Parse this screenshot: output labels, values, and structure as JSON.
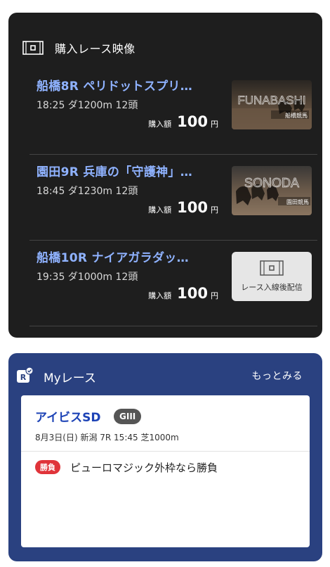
{
  "purchased_videos": {
    "title": "購入レース映像",
    "header_icon": "film-frame-icon",
    "races": [
      {
        "title": "船橋8R ペリドットスプリ…",
        "meta": "18:25 ダ1200m 12頭",
        "amount_label": "購入額",
        "amount": "100",
        "currency": "円",
        "thumbnail": {
          "text": "FUNABASHI",
          "caption": "船橋競馬",
          "tint": "#5a4a3a"
        }
      },
      {
        "title": "園田9R 兵庫の「守護神」…",
        "meta": "18:45 ダ1230m 12頭",
        "amount_label": "購入額",
        "amount": "100",
        "currency": "円",
        "thumbnail": {
          "text": "SONODA",
          "caption": "園田競馬",
          "tint": "#6b5a4a"
        }
      },
      {
        "title": "船橋10R ナイアガラダッ…",
        "meta": "19:35 ダ1000m 12頭",
        "amount_label": "購入額",
        "amount": "100",
        "currency": "円",
        "placeholder_text": "レース入線後配信",
        "placeholder_icon": "film-frame-icon"
      }
    ]
  },
  "my_race": {
    "title": "Myレース",
    "logo_letter": "R",
    "more_label": "もっとみる",
    "race_name": "アイビスSD",
    "grade": "GIII",
    "meta": "8月3日(日) 新潟 7R 15:45 芝1000m",
    "tag": "勝負",
    "comment": "ピューロマジック外枠なら勝負"
  },
  "colors": {
    "video_card_bg": "#1e1e1e",
    "race_title": "#8fb2ff",
    "my_card_bg": "#2a4180",
    "race_name": "#1d43b6",
    "tag_red": "#e0343a"
  }
}
